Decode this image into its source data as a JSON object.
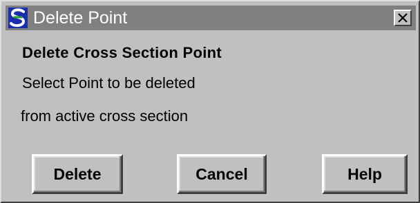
{
  "window": {
    "title": "Delete Point",
    "icon": "app-s-logo-icon",
    "close_icon": "close-icon"
  },
  "content": {
    "heading": "Delete Cross Section Point",
    "instruction_line1": "Select Point to be deleted",
    "instruction_line2": "from active cross section"
  },
  "buttons": {
    "delete_label": "Delete",
    "cancel_label": "Cancel",
    "help_label": "Help"
  },
  "colors": {
    "titlebar": "#808080",
    "window_bg": "#c0c0c0",
    "icon_blue": "#1a2fb0",
    "icon_green": "#2aa02a"
  }
}
